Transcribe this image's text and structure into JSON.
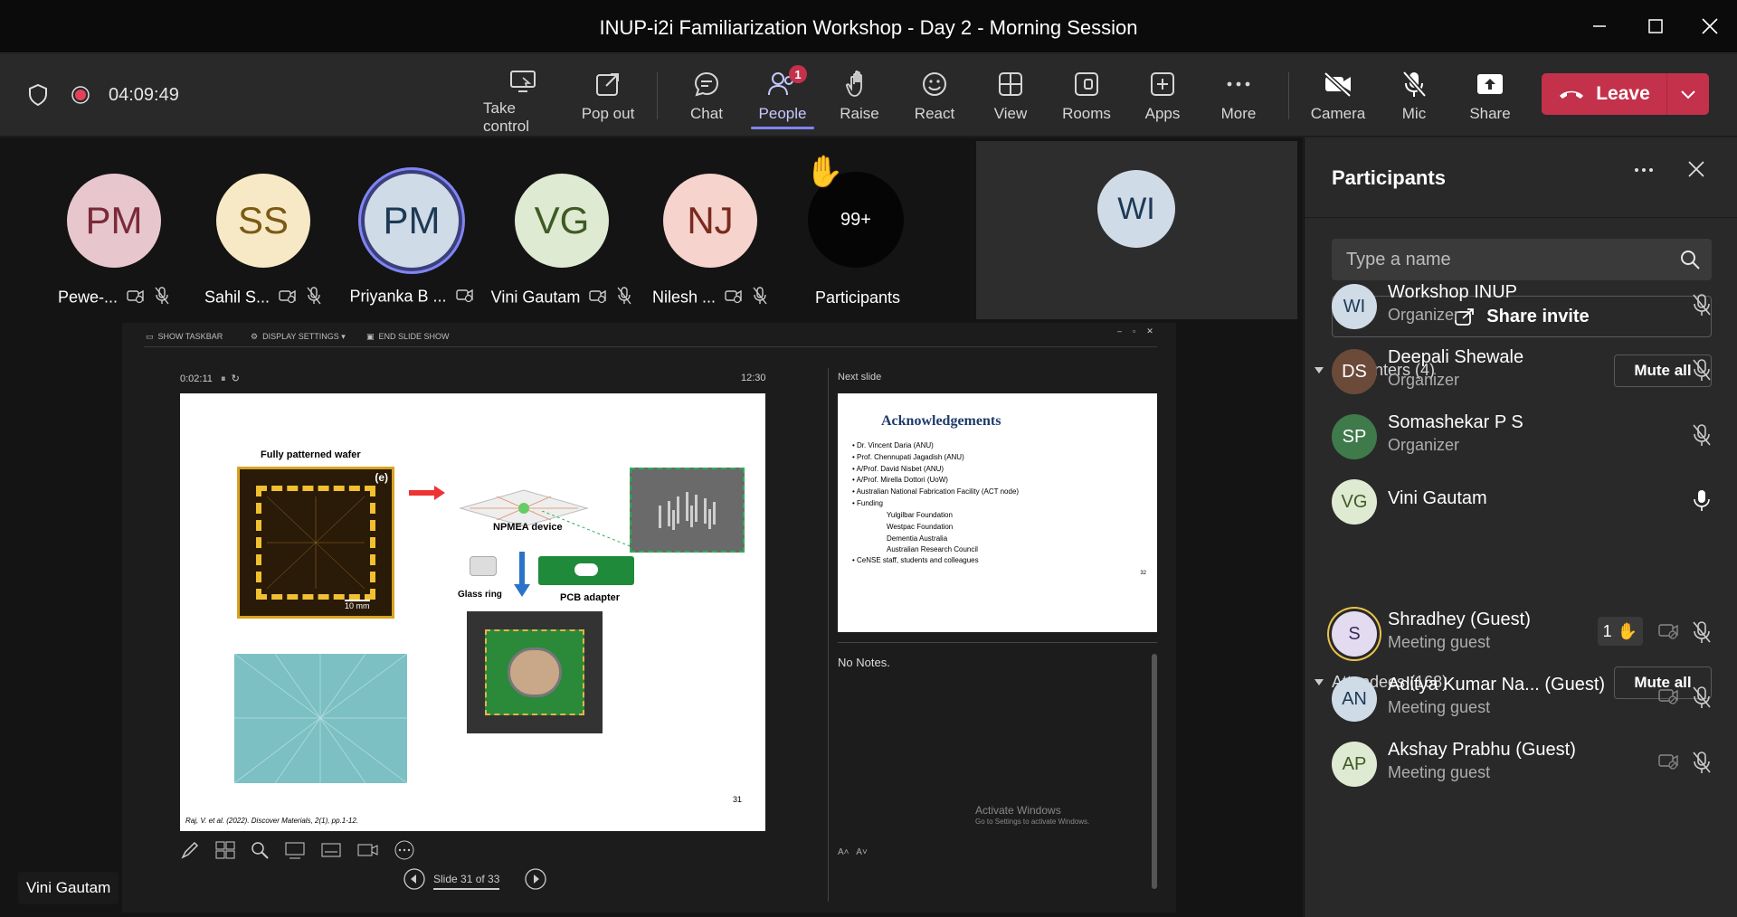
{
  "window": {
    "title": "INUP-i2i Familiarization Workshop - Day 2 - Morning Session"
  },
  "toolbar": {
    "timer": "04:09:49",
    "take_control": "Take control",
    "pop_out": "Pop out",
    "chat": "Chat",
    "people": "People",
    "people_badge": "1",
    "raise": "Raise",
    "react": "React",
    "view": "View",
    "rooms": "Rooms",
    "apps": "Apps",
    "more": "More",
    "camera": "Camera",
    "mic": "Mic",
    "share": "Share",
    "leave": "Leave"
  },
  "stage": {
    "tiles": [
      {
        "initials": "PM",
        "name": "Pewe-...",
        "bg": "#e7c7cd",
        "fg": "#7a2a3a"
      },
      {
        "initials": "SS",
        "name": "Sahil S...",
        "bg": "#f8e9c6",
        "fg": "#7a5a15"
      },
      {
        "initials": "PM",
        "name": "Priyanka B ...",
        "bg": "#cfdbe7",
        "fg": "#1d3a55"
      },
      {
        "initials": "VG",
        "name": "Vini Gautam",
        "bg": "#dfead2",
        "fg": "#3f5a25"
      },
      {
        "initials": "NJ",
        "name": "Nilesh ...",
        "bg": "#f6d3cc",
        "fg": "#7a2a1e"
      }
    ],
    "overflow_count": "99+",
    "overflow_label": "Participants",
    "wi_initials": "WI",
    "active_speaker_label": "Vini Gautam"
  },
  "presentation": {
    "show_taskbar": "SHOW TASKBAR",
    "display_settings": "DISPLAY SETTINGS ▾",
    "end_slide_show": "END SLIDE SHOW",
    "elapsed": "0:02:11",
    "clock": "12:30",
    "next_slide_label": "Next slide",
    "notes": "No Notes.",
    "slide_counter": "Slide 31 of 33",
    "activate_windows": "Activate Windows",
    "activate_windows_sub": "Go to Settings to activate Windows.",
    "slide": {
      "fully_patterned_wafer": "Fully patterned wafer",
      "label_e": "(e)",
      "scale_10mm": "10 mm",
      "npmea_device": "NPMEA device",
      "glass_ring": "Glass ring",
      "pcb_adapter": "PCB adapter",
      "citation": "Raj, V. et al. (2022). Discover Materials, 2(1), pp.1-12.",
      "page_number": "31"
    },
    "next_slide": {
      "title": "Acknowledgements",
      "items": [
        "• Dr. Vincent Daria (ANU)",
        "• Prof. Chennupati Jagadish (ANU)",
        "• A/Prof. David Nisbet (ANU)",
        "• A/Prof. Mirella Dottori (UoW)",
        "• Australian National Fabrication Facility (ACT node)",
        "• Funding"
      ],
      "funding": [
        "Yulgilbar Foundation",
        "Westpac Foundation",
        "Dementia Australia",
        "Australian Research Council"
      ],
      "last_item": "•  CeNSE staff, students and colleagues",
      "page_number": "32"
    }
  },
  "panel": {
    "title": "Participants",
    "search_placeholder": "Type a name",
    "share_invite": "Share invite",
    "presenters_header": "Presenters (4)",
    "attendees_header": "Attendees (168)",
    "mute_all": "Mute all",
    "presenters": [
      {
        "initials": "WI",
        "name": "Workshop INUP",
        "role": "Organizer",
        "bg": "#cfdbe7",
        "fg": "#1d3a55"
      },
      {
        "initials": "DS",
        "name": "Deepali Shewale",
        "role": "Organizer",
        "bg": "#6b4a3a",
        "fg": "#ffffff"
      },
      {
        "initials": "SP",
        "name": "Somashekar P S",
        "role": "Organizer",
        "bg": "#3f7a4a",
        "fg": "#ffffff"
      },
      {
        "initials": "VG",
        "name": "Vini Gautam",
        "role": "",
        "bg": "#dfead2",
        "fg": "#3f5a25"
      }
    ],
    "attendees": [
      {
        "initials": "S",
        "name": "Shradhey (Guest)",
        "role": "Meeting guest",
        "bg": "#e3dcf0",
        "fg": "#3a2a5a",
        "hand_count": "1"
      },
      {
        "initials": "AN",
        "name": "Aditya Kumar Na... (Guest)",
        "role": "Meeting guest",
        "bg": "#cfdbe7",
        "fg": "#1d3a55"
      },
      {
        "initials": "AP",
        "name": "Akshay Prabhu (Guest)",
        "role": "Meeting guest",
        "bg": "#dfead2",
        "fg": "#3f5a25"
      }
    ]
  },
  "colors": {
    "accent": "#7f85f5",
    "leave": "#c4314b",
    "badge": "#c4314b"
  }
}
